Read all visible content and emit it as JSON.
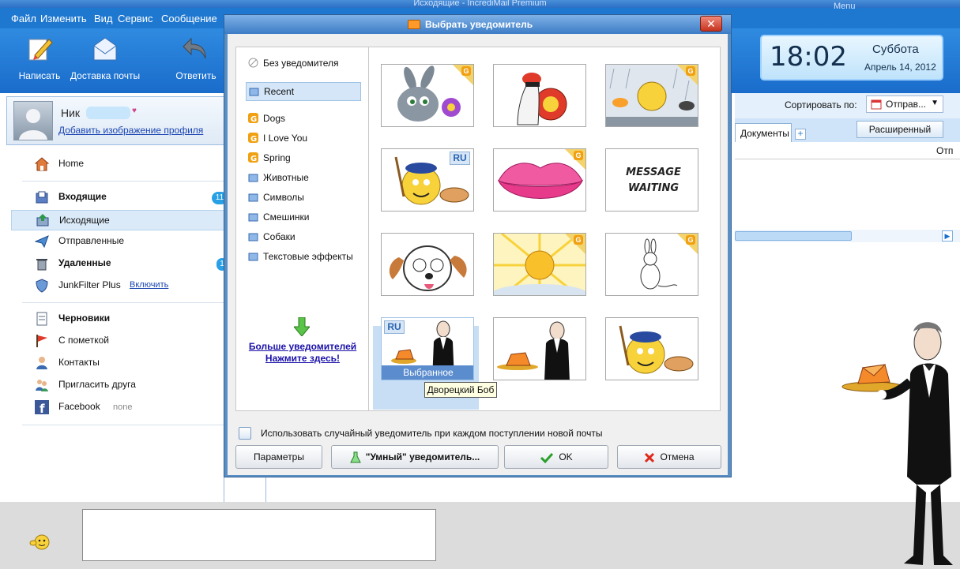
{
  "window": {
    "title": "Исходящие - IncrediMail Premium",
    "menu_label": "Menu"
  },
  "menubar": [
    "Файл",
    "Изменить",
    "Вид",
    "Сервис",
    "Сообщение"
  ],
  "toolbar": {
    "compose": "Написать",
    "deliver": "Доставка почты",
    "reply": "Ответить"
  },
  "clock": {
    "time": "18:02",
    "day": "Суббота",
    "date": "Апрель 14, 2012"
  },
  "sort": {
    "label": "Сортировать по:",
    "value": "Отправ..."
  },
  "tabs": {
    "documents": "Документы",
    "advanced": "Расширенный",
    "column_header": "Отп"
  },
  "profile": {
    "name": "Ник",
    "add_image": "Добавить изображение профиля"
  },
  "nav": [
    {
      "label": "Home",
      "icon": "home-icon"
    },
    {
      "label": "Входящие",
      "icon": "inbox-icon",
      "badge": "11"
    },
    {
      "label": "Исходящие",
      "icon": "outbox-icon"
    },
    {
      "label": "Отправленные",
      "icon": "sent-icon"
    },
    {
      "label": "Удаленные",
      "icon": "trash-icon",
      "badge": "1"
    },
    {
      "label": "JunkFilter Plus",
      "icon": "shield-icon",
      "link": "Включить"
    },
    {
      "label": "Черновики",
      "icon": "drafts-icon"
    },
    {
      "label": "С пометкой",
      "icon": "flag-icon"
    },
    {
      "label": "Контакты",
      "icon": "contacts-icon"
    },
    {
      "label": "Пригласить друга",
      "icon": "invite-icon"
    },
    {
      "label": "Facebook",
      "icon": "facebook-icon",
      "extra": "none"
    }
  ],
  "dialog": {
    "title": "Выбрать уведомитель",
    "categories": [
      "Без уведомителя",
      "Recent",
      "Dogs",
      "I Love You",
      "Spring",
      "Животные",
      "Символы",
      "Смешинки",
      "Собаки",
      "Текстовые эффекты"
    ],
    "more_line1": "Больше уведомителей",
    "more_line2": "Нажмите здесь!",
    "message_waiting": "MESSAGE WAITING",
    "selected_label": "Выбранное",
    "tooltip": "Дворецкий Боб",
    "random_checkbox": "Использовать случайный уведомитель при каждом поступлении новой почты",
    "buttons": {
      "params": "Параметры",
      "smart": "\"Умный\" уведомитель...",
      "ok": "OK",
      "cancel": "Отмена"
    }
  },
  "colors": {
    "brand_blue": "#1f78d0",
    "selection": "#5b8dce",
    "badge": "#27a0e6"
  }
}
